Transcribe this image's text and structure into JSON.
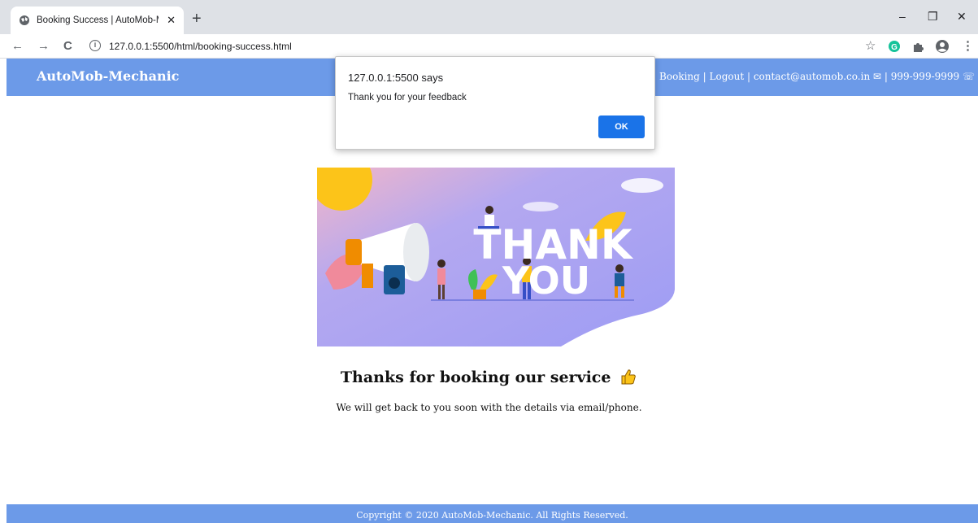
{
  "browser": {
    "tab_title": "Booking Success | AutoMob-Mec",
    "tab_close": "✕",
    "new_tab": "+",
    "url": "127.0.0.1:5500/html/booking-success.html",
    "back": "←",
    "forward": "→",
    "reload": "C",
    "info": "i",
    "star": "☆",
    "minimize": "–",
    "restore": "❐",
    "close": "✕",
    "menu": "⋮"
  },
  "header": {
    "brand": "AutoMob-Mechanic",
    "nav_text": "es | Booking | Logout | contact@automob.co.in ✉ | 999-999-9999 ☏"
  },
  "hero": {
    "line1": "THANK",
    "line2": "YOU"
  },
  "main": {
    "title": "Thanks for booking our service",
    "subtitle": "We will get back to you soon with the details via email/phone."
  },
  "footer": {
    "copyright": "Copyright © 2020 AutoMob-Mechanic.  All Rights Reserved."
  },
  "alert": {
    "origin": "127.0.0.1:5500 says",
    "message": "Thank you for your feedback",
    "ok_label": "OK"
  },
  "colors": {
    "header_bg": "#6c9ae8",
    "alert_button": "#1a73e8",
    "hero_bg": "#a29ef5"
  }
}
